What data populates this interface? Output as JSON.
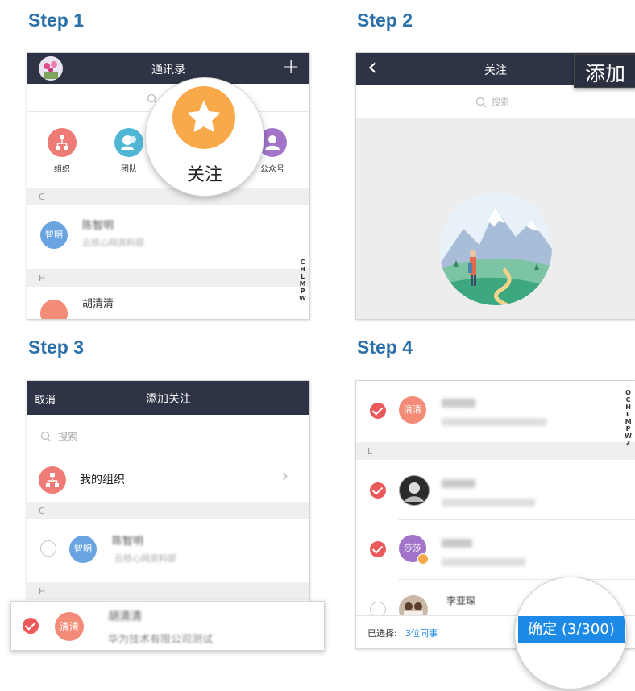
{
  "steps": {
    "step1": {
      "title": "Step 1",
      "nav_title": "通讯录",
      "add_symbol": "+",
      "icons": [
        {
          "label": "组织",
          "icon": "org-icon",
          "color": "#ee7b75"
        },
        {
          "label": "团队",
          "icon": "team-icon",
          "color": "#4fb7d4"
        },
        {
          "label": "公众号",
          "icon": "public-account-icon",
          "color": "#a274c9"
        }
      ],
      "follow_label": "关注",
      "follow_color": "#f8a949",
      "section_c": "C",
      "section_h": "H",
      "contact1_avatar": "智明",
      "contact1_name": "陈智明",
      "contact1_dept": "云核心网资料部",
      "contact2_name": "胡清清",
      "index_letters": [
        "C",
        "H",
        "L",
        "M",
        "P",
        "W"
      ]
    },
    "step2": {
      "title": "Step 2",
      "nav_title": "关注",
      "back_symbol": "‹",
      "add_label": "添加",
      "search_placeholder": "搜索"
    },
    "step3": {
      "title": "Step 3",
      "cancel_label": "取消",
      "nav_title": "添加关注",
      "search_placeholder": "搜索",
      "my_org_label": "我的组织",
      "chevron": "›",
      "section_c": "C",
      "section_h": "H",
      "contact1_avatar": "智明",
      "contact1_name": "陈智明",
      "contact1_dept": "云核心网资料部",
      "contact2_avatar": "清清",
      "contact2_name": "胡清清",
      "contact2_company": "华为技术有限公司测试"
    },
    "step4": {
      "title": "Step 4",
      "avatar1": "清清",
      "section_l": "L",
      "avatar3": "莎莎",
      "name4": "李亚琛",
      "selected_prefix": "已选择: ",
      "selected_count": "3位同事",
      "confirm_label": "确定 (3/300)",
      "index_letters": [
        "Q",
        "C",
        "H",
        "L",
        "M",
        "P",
        "W",
        "Z"
      ]
    }
  },
  "colors": {
    "navbar": "#2e3445",
    "step_title": "#2a6fa8",
    "check_red": "#ea5a5a",
    "confirm_blue": "#1d8ae8"
  }
}
